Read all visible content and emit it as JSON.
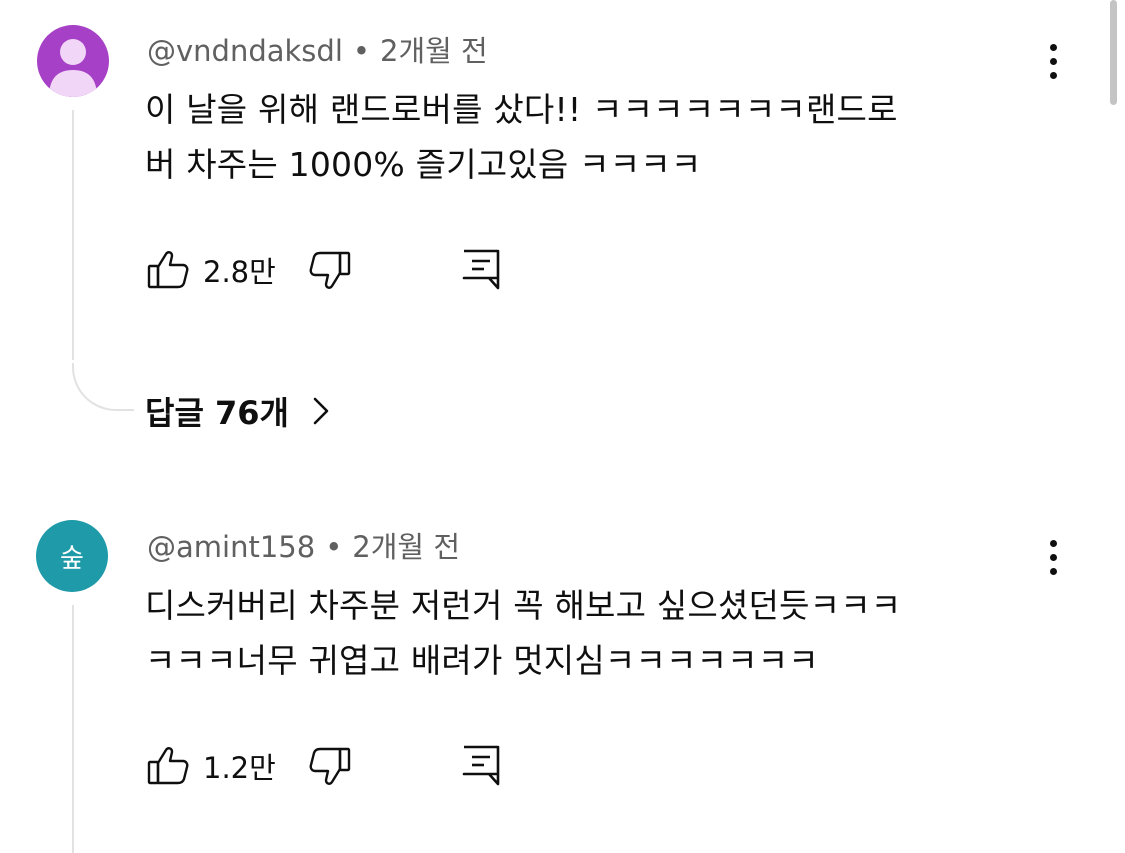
{
  "comments": [
    {
      "handle": "@vndndaksdl",
      "time": "2개월 전",
      "avatar_letter": "",
      "avatar_color": "#a640c6",
      "line1": "이 날을 위해 랜드로버를 샀다!! ㅋㅋㅋㅋㅋㅋㅋ랜드로",
      "line2": "버 차주는 1000% 즐기고있음 ㅋㅋㅋㅋ",
      "likes": "2.8만",
      "replies_label": "답글 76개"
    },
    {
      "handle": "@amint158",
      "time": "2개월 전",
      "avatar_letter": "숲",
      "avatar_color": "#1e9aa8",
      "line1": "디스커버리 차주분 저런거 꼭 해보고 싶으셨던듯ㅋㅋㅋ",
      "line2": "ㅋㅋㅋ너무 귀엽고 배려가 멋지심ㅋㅋㅋㅋㅋㅋㅋ",
      "likes": "1.2만"
    }
  ],
  "separator": "•",
  "icons": [
    "default-avatar-icon",
    "like-icon",
    "dislike-icon",
    "reply-icon",
    "more-options-icon",
    "chevron-right-icon"
  ]
}
